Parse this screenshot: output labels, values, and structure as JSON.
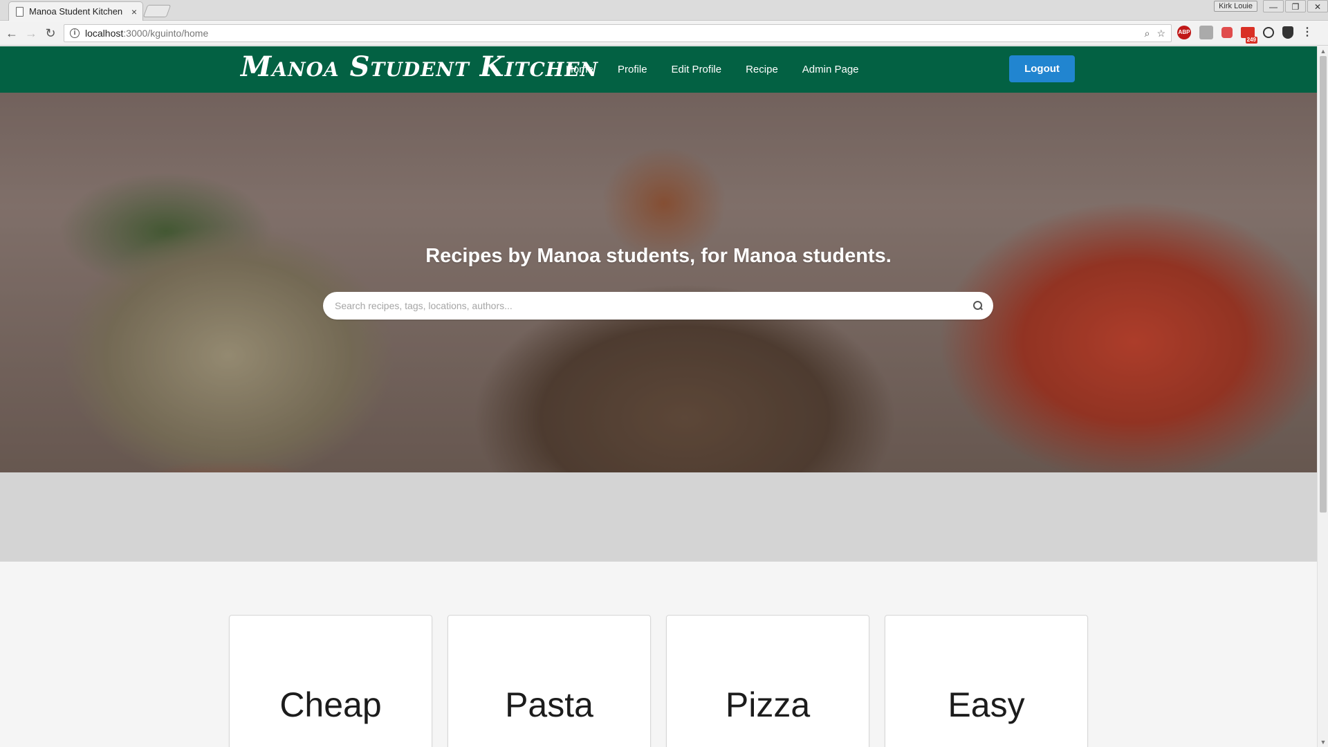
{
  "browser": {
    "tab_title": "Manoa Student Kitchen",
    "tab_close": "×",
    "url_host": "localhost",
    "url_path": ":3000/kguinto/home",
    "user_chip": "Kirk Louie",
    "mail_badge": "249",
    "ext_abp": "ABP",
    "back_glyph": "←",
    "forward_glyph": "→",
    "reload_glyph": "↻",
    "zoom_glyph": "⌕",
    "star_glyph": "☆",
    "menu_glyph": "⋮",
    "win_min": "—",
    "win_restore": "❐",
    "win_close": "✕"
  },
  "navbar": {
    "brand": "Manoa Student Kitchen",
    "links": [
      "Home",
      "Profile",
      "Edit Profile",
      "Recipe",
      "Admin Page"
    ],
    "logout_label": "Logout",
    "bg_color": "#036143",
    "button_color": "#2185d0"
  },
  "hero": {
    "title": "Recipes by Manoa students, for Manoa students.",
    "search_placeholder": "Search recipes, tags, locations, authors..."
  },
  "categories": [
    "Cheap",
    "Pasta",
    "Pizza",
    "Easy"
  ]
}
